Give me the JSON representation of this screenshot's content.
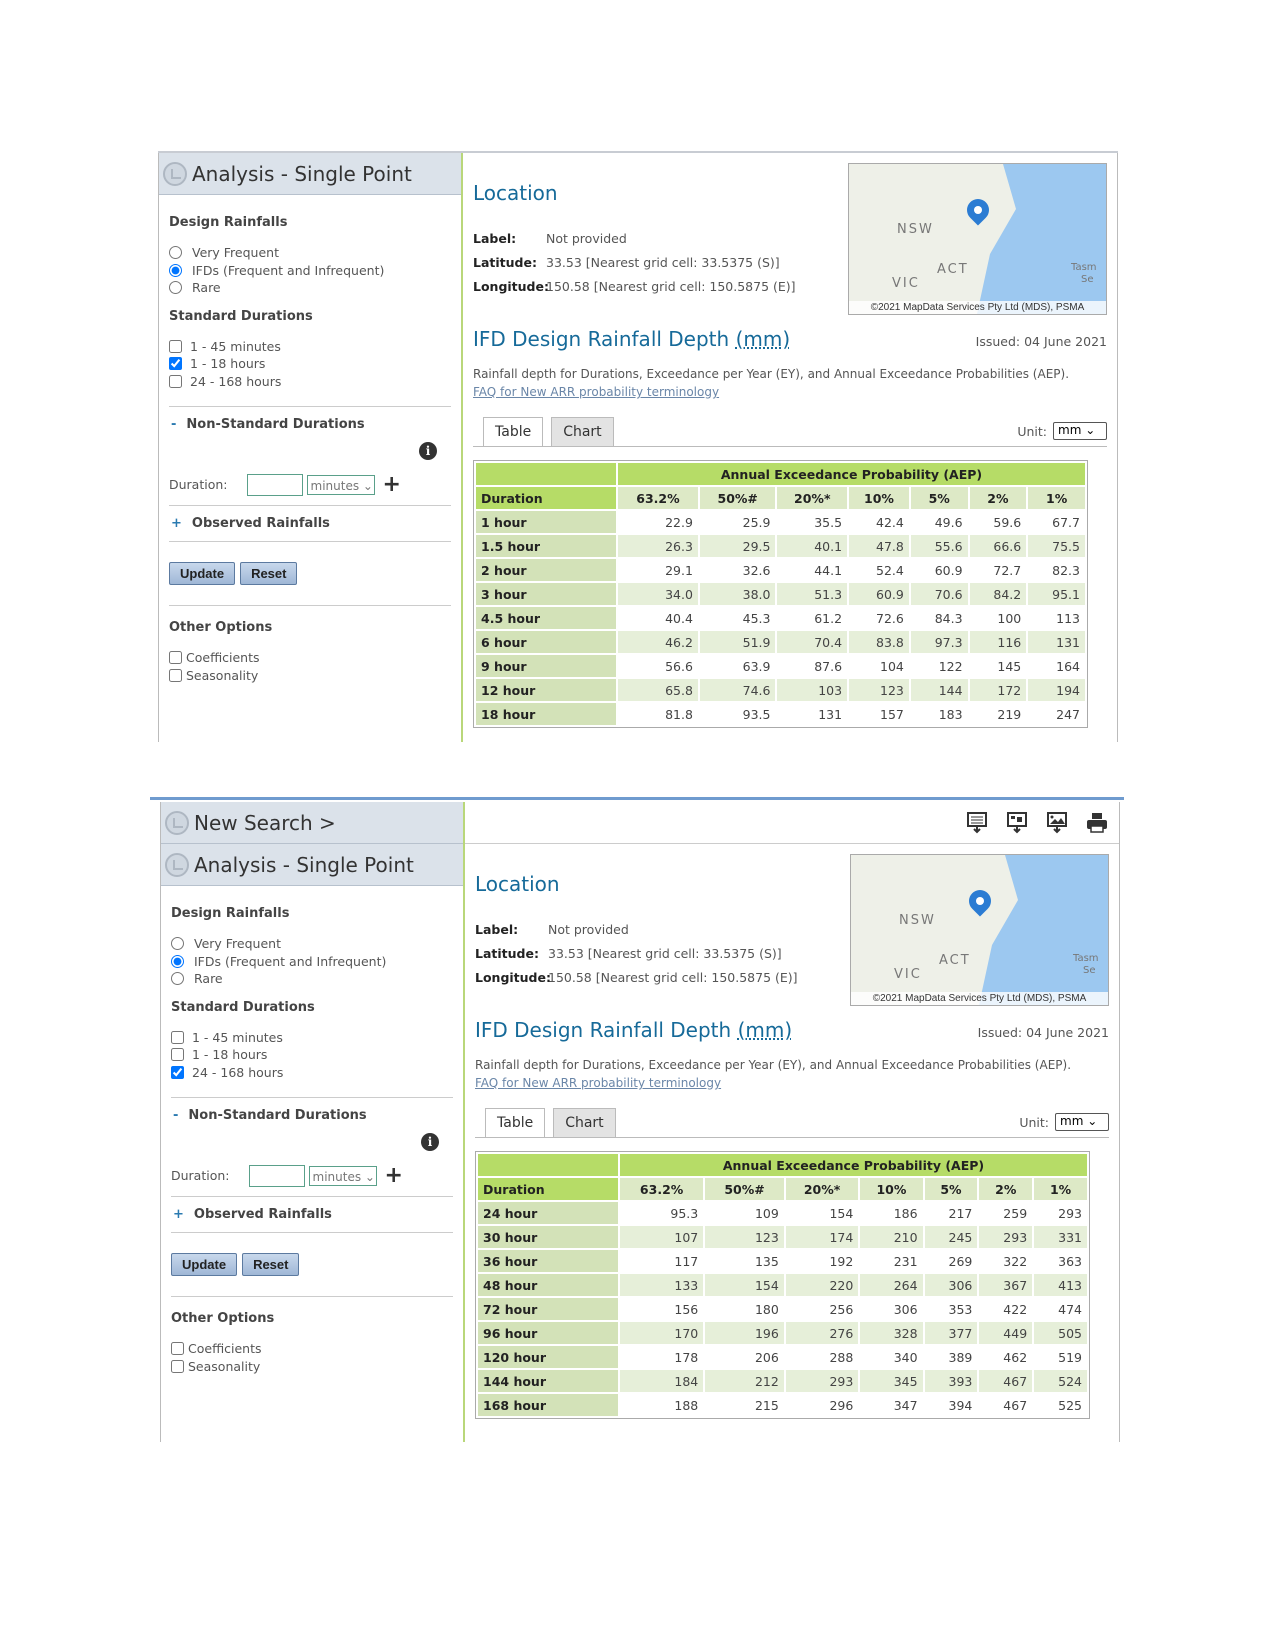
{
  "colors": {
    "accent": "#166a99",
    "table_header": "#b6dc67",
    "separator": "#6f9bcf"
  },
  "panels": [
    {
      "new_search": null,
      "sidebar": {
        "title": "Analysis - Single Point",
        "design_rainfalls": "Design Rainfalls",
        "radios": [
          {
            "label": "Very Frequent",
            "checked": false
          },
          {
            "label": "IFDs (Frequent and Infrequent)",
            "checked": true
          },
          {
            "label": "Rare",
            "checked": false
          }
        ],
        "standard_durations": "Standard Durations",
        "checks": [
          {
            "label": "1 - 45 minutes",
            "checked": false
          },
          {
            "label": "1 - 18 hours",
            "checked": true
          },
          {
            "label": "24 - 168 hours",
            "checked": false
          }
        ],
        "nonstandard": "Non-Standard Durations",
        "nonstandard_sym": "-",
        "duration_label": "Duration:",
        "duration_value": "",
        "duration_unit": "minutes",
        "observed": "Observed Rainfalls",
        "observed_sym": "+",
        "update": "Update",
        "reset": "Reset",
        "other_options": "Other Options",
        "other": [
          {
            "label": "Coefficients",
            "checked": false
          },
          {
            "label": "Seasonality",
            "checked": false
          }
        ]
      },
      "main": {
        "location_title": "Location",
        "label_key": "Label:",
        "label_value": "Not provided",
        "lat_key": "Latitude:",
        "lat_value": "33.53 [Nearest grid cell: 33.5375 (S)]",
        "lon_key": "Longitude:",
        "lon_value": "150.58 [Nearest grid cell: 150.5875 (E)]",
        "map": {
          "labels": [
            "NSW",
            "ACT",
            "VIC",
            "Tasm",
            "Se"
          ],
          "copyright": "©2021 MapData Services Pty Ltd (MDS), PSMA"
        },
        "ifd_title": "IFD Design Rainfall Depth",
        "ifd_unit": "(mm)",
        "issued": "Issued: 04 June 2021",
        "description": "Rainfall depth for Durations, Exceedance per Year (EY), and Annual Exceedance Probabilities (AEP).",
        "faq": "FAQ for New ARR probability terminology",
        "tabs": [
          "Table",
          "Chart"
        ],
        "unit_label": "Unit:",
        "unit_value": "mm",
        "table": {
          "group_header": "Annual Exceedance Probability (AEP)",
          "duration_header": "Duration",
          "columns": [
            "63.2%",
            "50%#",
            "20%*",
            "10%",
            "5%",
            "2%",
            "1%"
          ],
          "rows": [
            {
              "d": "1 hour",
              "v": [
                "22.9",
                "25.9",
                "35.5",
                "42.4",
                "49.6",
                "59.6",
                "67.7"
              ]
            },
            {
              "d": "1.5 hour",
              "v": [
                "26.3",
                "29.5",
                "40.1",
                "47.8",
                "55.6",
                "66.6",
                "75.5"
              ]
            },
            {
              "d": "2 hour",
              "v": [
                "29.1",
                "32.6",
                "44.1",
                "52.4",
                "60.9",
                "72.7",
                "82.3"
              ]
            },
            {
              "d": "3 hour",
              "v": [
                "34.0",
                "38.0",
                "51.3",
                "60.9",
                "70.6",
                "84.2",
                "95.1"
              ]
            },
            {
              "d": "4.5 hour",
              "v": [
                "40.4",
                "45.3",
                "61.2",
                "72.6",
                "84.3",
                "100",
                "113"
              ]
            },
            {
              "d": "6 hour",
              "v": [
                "46.2",
                "51.9",
                "70.4",
                "83.8",
                "97.3",
                "116",
                "131"
              ]
            },
            {
              "d": "9 hour",
              "v": [
                "56.6",
                "63.9",
                "87.6",
                "104",
                "122",
                "145",
                "164"
              ]
            },
            {
              "d": "12 hour",
              "v": [
                "65.8",
                "74.6",
                "103",
                "123",
                "144",
                "172",
                "194"
              ]
            },
            {
              "d": "18 hour",
              "v": [
                "81.8",
                "93.5",
                "131",
                "157",
                "183",
                "219",
                "247"
              ]
            }
          ]
        }
      }
    },
    {
      "new_search": "New Search >",
      "toolbar_icons": [
        "download-table-icon",
        "download-chart-icon",
        "download-image-icon",
        "print-icon"
      ],
      "sidebar": {
        "title": "Analysis - Single Point",
        "design_rainfalls": "Design Rainfalls",
        "radios": [
          {
            "label": "Very Frequent",
            "checked": false
          },
          {
            "label": "IFDs (Frequent and Infrequent)",
            "checked": true
          },
          {
            "label": "Rare",
            "checked": false
          }
        ],
        "standard_durations": "Standard Durations",
        "checks": [
          {
            "label": "1 - 45 minutes",
            "checked": false
          },
          {
            "label": "1 - 18 hours",
            "checked": false
          },
          {
            "label": "24 - 168 hours",
            "checked": true
          }
        ],
        "nonstandard": "Non-Standard Durations",
        "nonstandard_sym": "-",
        "duration_label": "Duration:",
        "duration_value": "",
        "duration_unit": "minutes",
        "observed": "Observed Rainfalls",
        "observed_sym": "+",
        "update": "Update",
        "reset": "Reset",
        "other_options": "Other Options",
        "other": [
          {
            "label": "Coefficients",
            "checked": false
          },
          {
            "label": "Seasonality",
            "checked": false
          }
        ]
      },
      "main": {
        "location_title": "Location",
        "label_key": "Label:",
        "label_value": "Not provided",
        "lat_key": "Latitude:",
        "lat_value": "33.53 [Nearest grid cell: 33.5375 (S)]",
        "lon_key": "Longitude:",
        "lon_value": "150.58 [Nearest grid cell: 150.5875 (E)]",
        "map": {
          "labels": [
            "NSW",
            "ACT",
            "VIC",
            "Tasm",
            "Se"
          ],
          "copyright": "©2021 MapData Services Pty Ltd (MDS), PSMA"
        },
        "ifd_title": "IFD Design Rainfall Depth",
        "ifd_unit": "(mm)",
        "issued": "Issued: 04 June 2021",
        "description": "Rainfall depth for Durations, Exceedance per Year (EY), and Annual Exceedance Probabilities (AEP).",
        "faq": "FAQ for New ARR probability terminology",
        "tabs": [
          "Table",
          "Chart"
        ],
        "unit_label": "Unit:",
        "unit_value": "mm",
        "table": {
          "group_header": "Annual Exceedance Probability (AEP)",
          "duration_header": "Duration",
          "columns": [
            "63.2%",
            "50%#",
            "20%*",
            "10%",
            "5%",
            "2%",
            "1%"
          ],
          "rows": [
            {
              "d": "24 hour",
              "v": [
                "95.3",
                "109",
                "154",
                "186",
                "217",
                "259",
                "293"
              ]
            },
            {
              "d": "30 hour",
              "v": [
                "107",
                "123",
                "174",
                "210",
                "245",
                "293",
                "331"
              ]
            },
            {
              "d": "36 hour",
              "v": [
                "117",
                "135",
                "192",
                "231",
                "269",
                "322",
                "363"
              ]
            },
            {
              "d": "48 hour",
              "v": [
                "133",
                "154",
                "220",
                "264",
                "306",
                "367",
                "413"
              ]
            },
            {
              "d": "72 hour",
              "v": [
                "156",
                "180",
                "256",
                "306",
                "353",
                "422",
                "474"
              ]
            },
            {
              "d": "96 hour",
              "v": [
                "170",
                "196",
                "276",
                "328",
                "377",
                "449",
                "505"
              ]
            },
            {
              "d": "120 hour",
              "v": [
                "178",
                "206",
                "288",
                "340",
                "389",
                "462",
                "519"
              ]
            },
            {
              "d": "144 hour",
              "v": [
                "184",
                "212",
                "293",
                "345",
                "393",
                "467",
                "524"
              ]
            },
            {
              "d": "168 hour",
              "v": [
                "188",
                "215",
                "296",
                "347",
                "394",
                "467",
                "525"
              ]
            }
          ]
        }
      }
    }
  ]
}
